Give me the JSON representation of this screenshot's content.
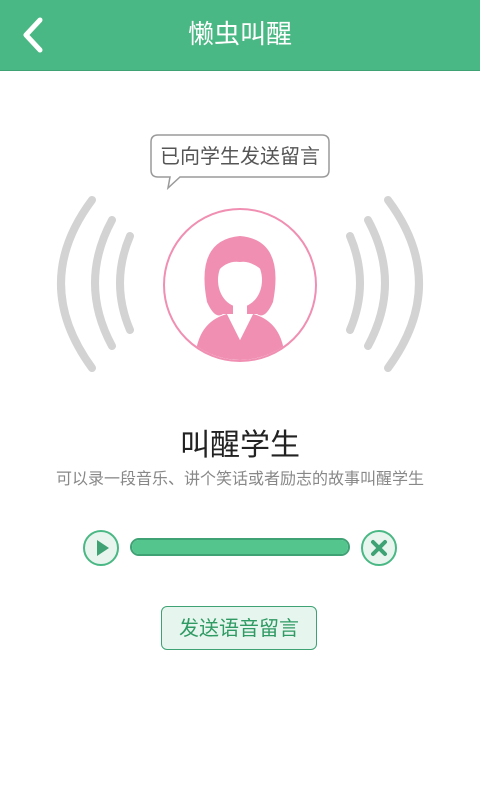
{
  "header": {
    "title": "懒虫叫醒"
  },
  "bubble": {
    "text": "已向学生发送留言"
  },
  "main": {
    "heading": "叫醒学生",
    "subheading": "可以录一段音乐、讲个笑话或者励志的故事叫醒学生"
  },
  "player": {
    "progress_percent": 100
  },
  "actions": {
    "send_label": "发送语音留言"
  },
  "colors": {
    "accent": "#4ab884",
    "avatar": "#f08fb2",
    "waves": "#d3d3d3"
  },
  "icons": {
    "back": "back-arrow-icon",
    "play": "play-icon",
    "close": "close-icon",
    "avatar": "female-avatar-icon"
  }
}
